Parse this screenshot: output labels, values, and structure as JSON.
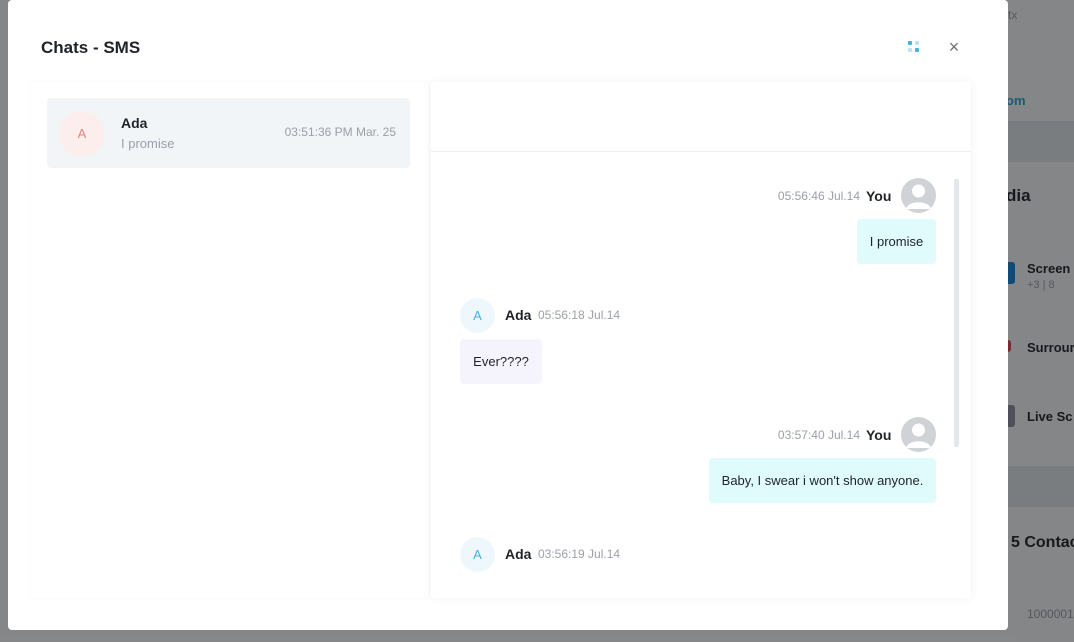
{
  "background": {
    "top_right_text": "tx",
    "link_fragment": "om",
    "section_title_fragment": "dia",
    "items": [
      {
        "label": "Screen",
        "sub": "+3 | 8",
        "color": "#1e88d8",
        "icon": "screen-icon"
      },
      {
        "label": "Surrour",
        "color": "#e84a5f",
        "icon": "surround-icon"
      },
      {
        "label": "Live Sc",
        "color": "#8c93a3",
        "icon": "live-icon"
      }
    ],
    "contacts_title_fragment": "5 Contac",
    "number_fragment": "1000001"
  },
  "modal": {
    "title": "Chats - SMS",
    "close_glyph": "×",
    "grid_icon": "grid-icon",
    "accent_color": "#45b2dd"
  },
  "chat_list": [
    {
      "initial": "A",
      "name": "Ada",
      "preview": "I promise",
      "time": "03:51:36 PM Mar. 25"
    }
  ],
  "messages": [
    {
      "direction": "out",
      "sender": "You",
      "time": "05:56:46 Jul.14",
      "text": "I promise"
    },
    {
      "direction": "in",
      "sender": "Ada",
      "initial": "A",
      "time": "05:56:18 Jul.14",
      "text": "Ever????"
    },
    {
      "direction": "out",
      "sender": "You",
      "time": "03:57:40 Jul.14",
      "text": "Baby, I swear i won't show anyone."
    },
    {
      "direction": "in",
      "sender": "Ada",
      "initial": "A",
      "time": "03:56:19 Jul.14",
      "text": ""
    }
  ]
}
